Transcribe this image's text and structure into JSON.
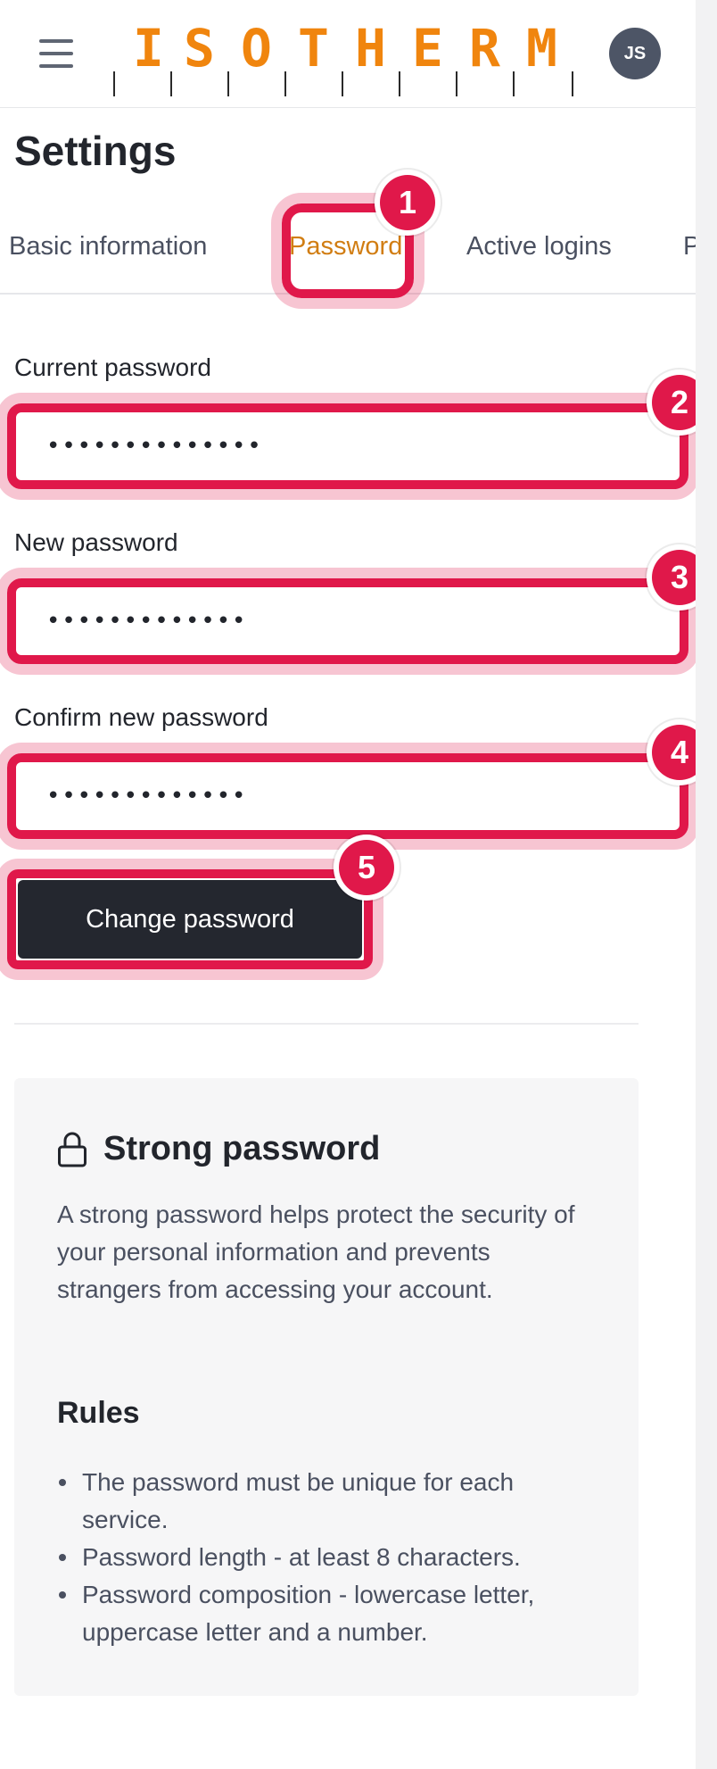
{
  "header": {
    "brand_letters": [
      "I",
      "S",
      "O",
      "T",
      "H",
      "E",
      "R",
      "M"
    ],
    "avatar_initials": "JS"
  },
  "page": {
    "title": "Settings"
  },
  "tabs": [
    {
      "label": "Basic information",
      "active": false
    },
    {
      "label": "Password",
      "active": true
    },
    {
      "label": "Active logins",
      "active": false
    },
    {
      "label": "Pre",
      "active": false
    }
  ],
  "form": {
    "current_password": {
      "label": "Current password",
      "value": "••••••••••••••"
    },
    "new_password": {
      "label": "New password",
      "value": "•••••••••••••"
    },
    "confirm_password": {
      "label": "Confirm new password",
      "value": "•••••••••••••"
    },
    "submit_label": "Change password"
  },
  "annotations": [
    "1",
    "2",
    "3",
    "4",
    "5"
  ],
  "info": {
    "title": "Strong password",
    "text": "A strong password helps protect the security of your personal information and prevents strangers from accessing your account.",
    "rules_title": "Rules",
    "rules": [
      "The password must be unique for each service.",
      "Password length - at least 8 characters.",
      "Password composition - lowercase letter, uppercase letter and a number."
    ]
  },
  "colors": {
    "brand": "#f0850e",
    "highlight": "#e0184a",
    "active_tab": "#d17d12",
    "button": "#24272f"
  },
  "icons": {
    "menu": "hamburger-menu-icon",
    "lock": "lock-icon"
  }
}
